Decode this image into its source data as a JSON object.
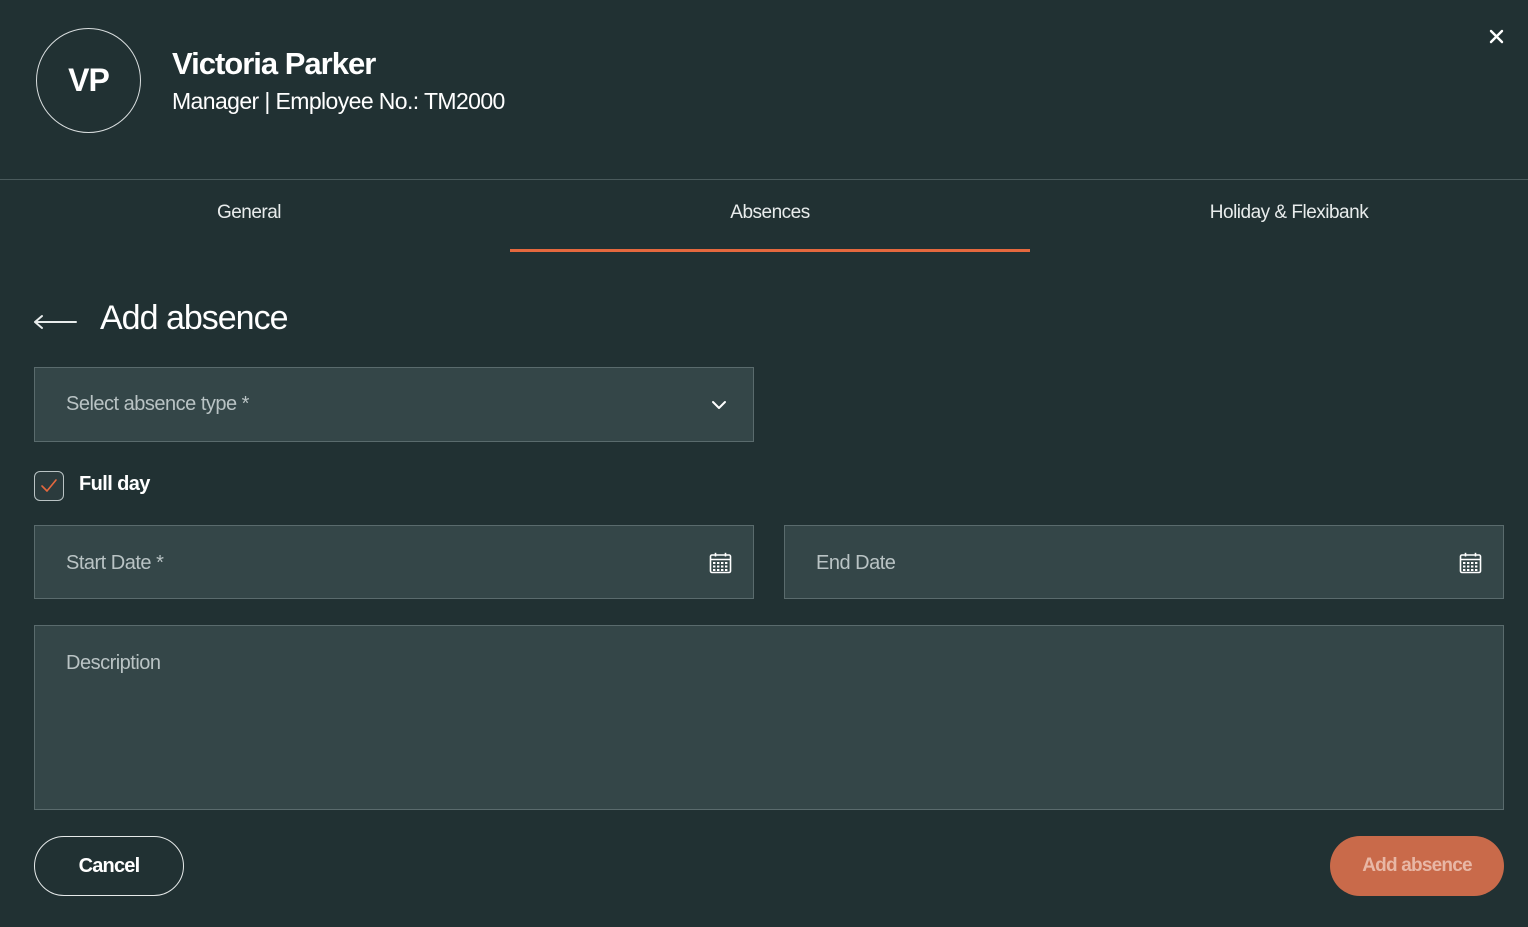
{
  "employee": {
    "initials": "VP",
    "name": "Victoria Parker",
    "subtitle": "Manager | Employee No.: TM2000"
  },
  "close_icon": "close-icon",
  "tabs": [
    {
      "label": "General",
      "active": false
    },
    {
      "label": "Absences",
      "active": true
    },
    {
      "label": "Holiday & Flexibank",
      "active": false
    }
  ],
  "section": {
    "back_icon": "arrow-left-icon",
    "title": "Add absence"
  },
  "form": {
    "absence_type": {
      "placeholder": "Select absence type *",
      "value": "",
      "icon": "chevron-down-icon"
    },
    "full_day": {
      "label": "Full day",
      "checked": true
    },
    "start_date": {
      "placeholder": "Start Date *",
      "value": "",
      "icon": "calendar-icon"
    },
    "end_date": {
      "placeholder": "End Date",
      "value": "",
      "icon": "calendar-icon"
    },
    "description": {
      "placeholder": "Description",
      "value": ""
    }
  },
  "actions": {
    "cancel_label": "Cancel",
    "submit_label": "Add absence"
  },
  "colors": {
    "background": "#213133",
    "field_background": "#344648",
    "accent": "#e4683e",
    "submit_button": "#c96a4a"
  }
}
